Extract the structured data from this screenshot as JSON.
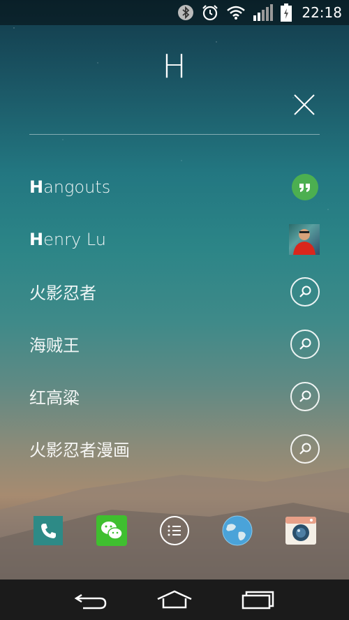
{
  "status_bar": {
    "time": "22:18",
    "icons": [
      "bluetooth-icon",
      "alarm-icon",
      "wifi-icon",
      "signal-icon",
      "battery-charging-icon"
    ]
  },
  "search": {
    "query": "H"
  },
  "results": [
    {
      "match": "H",
      "rest": "angouts",
      "icon": "hangouts-icon"
    },
    {
      "match": "H",
      "rest": "enry Lu",
      "icon": "contact-photo"
    },
    {
      "match": "",
      "rest": "火影忍者",
      "icon": "search-icon"
    },
    {
      "match": "",
      "rest": "海贼王",
      "icon": "search-icon"
    },
    {
      "match": "",
      "rest": "红高粱",
      "icon": "search-icon"
    },
    {
      "match": "",
      "rest": "火影忍者漫画",
      "icon": "search-icon"
    }
  ],
  "dock": [
    "phone-icon",
    "wechat-icon",
    "app-drawer-icon",
    "browser-globe-icon",
    "camera-icon"
  ],
  "nav_bar": [
    "back-icon",
    "home-icon",
    "recents-icon"
  ],
  "colors": {
    "hangouts_green": "#4caf50",
    "wechat_green": "#3fbf2f",
    "phone_teal": "#2d8a86"
  }
}
